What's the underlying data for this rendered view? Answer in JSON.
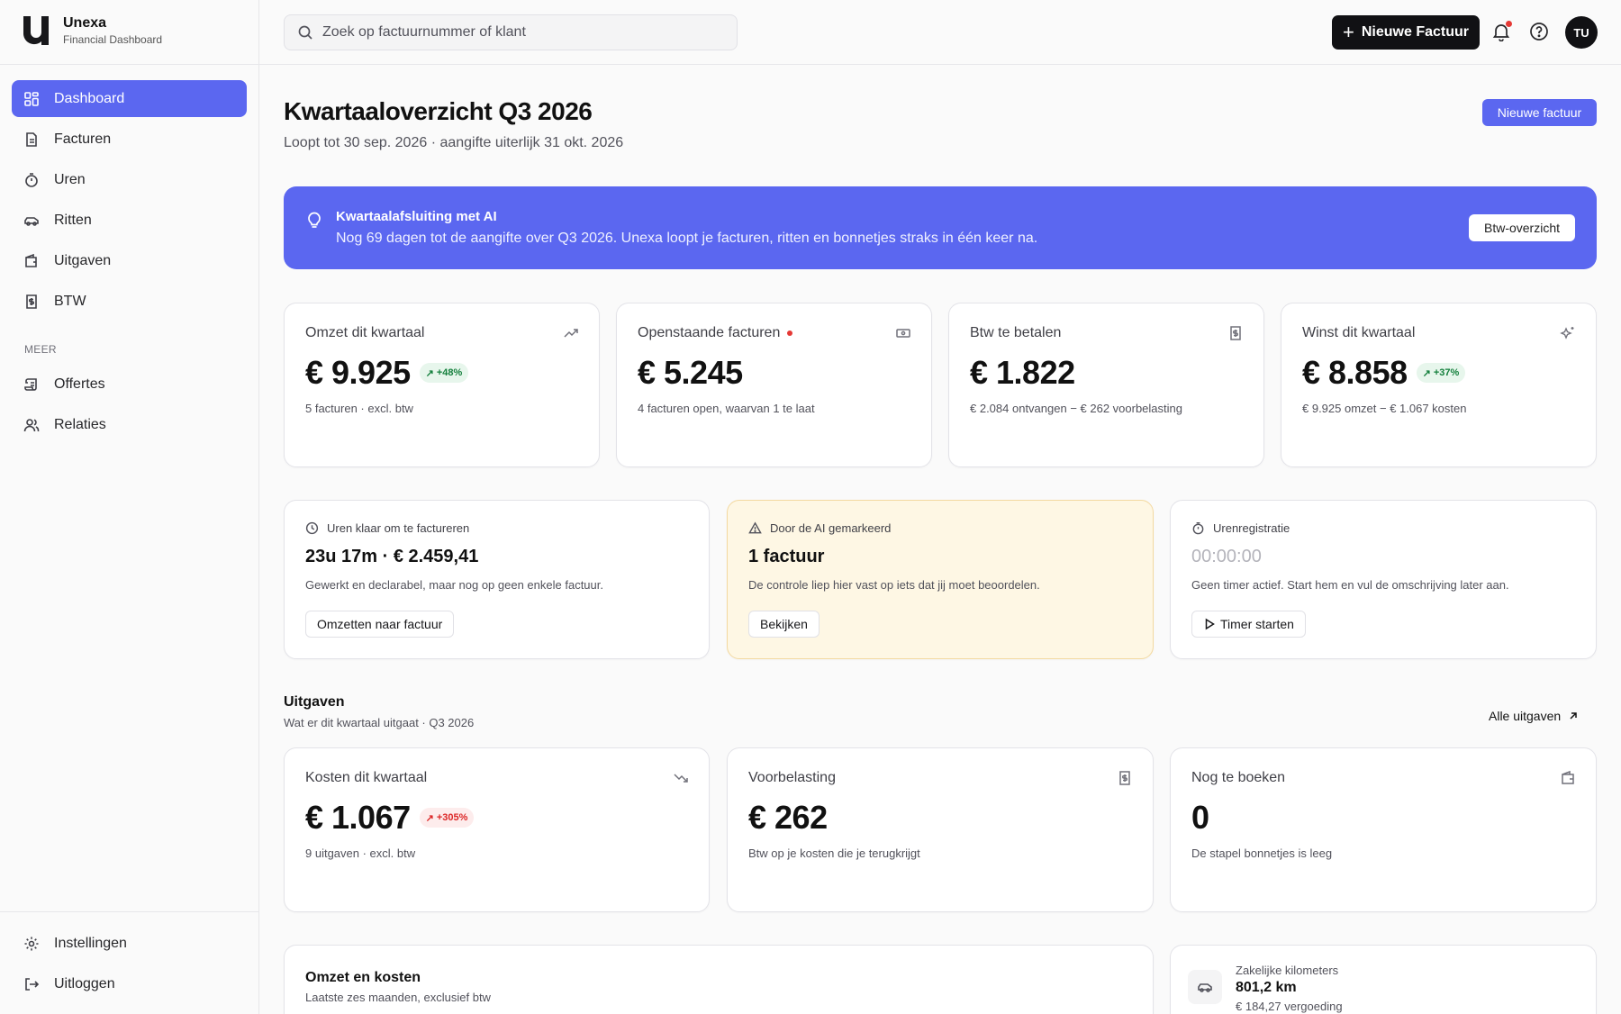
{
  "brand": {
    "name": "Unexa",
    "subtitle": "Financial Dashboard"
  },
  "sidebar": {
    "items": [
      {
        "label": "Dashboard",
        "icon": "dashboard-icon",
        "active": true
      },
      {
        "label": "Facturen",
        "icon": "file-icon"
      },
      {
        "label": "Uren",
        "icon": "stopwatch-icon"
      },
      {
        "label": "Ritten",
        "icon": "car-icon"
      },
      {
        "label": "Uitgaven",
        "icon": "wallet-icon"
      },
      {
        "label": "BTW",
        "icon": "receipt-icon"
      }
    ],
    "section_label": "MEER",
    "more_items": [
      {
        "label": "Offertes",
        "icon": "scroll-icon"
      },
      {
        "label": "Relaties",
        "icon": "users-icon"
      }
    ],
    "bottom_items": [
      {
        "label": "Instellingen",
        "icon": "gear-icon"
      },
      {
        "label": "Uitloggen",
        "icon": "logout-icon"
      }
    ]
  },
  "topbar": {
    "search_placeholder": "Zoek op factuurnummer of klant",
    "new_invoice_label": "Nieuwe Factuur",
    "avatar_initials": "TU",
    "notification_dot": true
  },
  "header": {
    "title": "Kwartaaloverzicht Q3 2026",
    "subtitle": "Loopt tot 30 sep. 2026 · aangifte uiterlijk 31 okt. 2026",
    "action_label": "Nieuwe factuur"
  },
  "banner": {
    "title": "Kwartaalafsluiting met AI",
    "text": "Nog 69 dagen tot de aangifte over Q3 2026. Unexa loopt je facturen, ritten en bonnetjes straks in één keer na.",
    "button_label": "Btw-overzicht"
  },
  "kpis": [
    {
      "label": "Omzet dit kwartaal",
      "value": "€ 9.925",
      "badge": "+48%",
      "badge_tone": "green",
      "note": "5 facturen · excl. btw",
      "icon": "trend-up-icon"
    },
    {
      "label": "Openstaande facturen",
      "value": "€ 5.245",
      "note": "4 facturen open, waarvan 1 te laat",
      "icon": "banknote-icon",
      "alert_dot": true
    },
    {
      "label": "Btw te betalen",
      "value": "€ 1.822",
      "note": "€ 2.084 ontvangen − € 262 voorbelasting",
      "icon": "receipt-icon"
    },
    {
      "label": "Winst dit kwartaal",
      "value": "€ 8.858",
      "badge": "+37%",
      "badge_tone": "green",
      "note": "€ 9.925 omzet − € 1.067 kosten",
      "icon": "sparkles-icon"
    }
  ],
  "actions": [
    {
      "head": "Uren klaar om te factureren",
      "value": "23u 17m · € 2.459,41",
      "note": "Gewerkt en declarabel, maar nog op geen enkele factuur.",
      "button": "Omzetten naar factuur",
      "icon": "clock-icon"
    },
    {
      "head": "Door de AI gemarkeerd",
      "value": "1 factuur",
      "note": "De controle liep hier vast op iets dat jij moet beoordelen.",
      "button": "Bekijken",
      "icon": "warning-icon"
    },
    {
      "head": "Urenregistratie",
      "value": "00:00:00",
      "note": "Geen timer actief. Start hem en vul de omschrijving later aan.",
      "button": "Timer starten",
      "icon": "timer-icon"
    }
  ],
  "expenses": {
    "title": "Uitgaven",
    "subtitle": "Wat er dit kwartaal uitgaat · Q3 2026",
    "link_label": "Alle uitgaven",
    "cards": [
      {
        "label": "Kosten dit kwartaal",
        "value": "€ 1.067",
        "badge": "+305%",
        "badge_tone": "red",
        "note": "9 uitgaven · excl. btw",
        "icon": "trend-down-icon"
      },
      {
        "label": "Voorbelasting",
        "value": "€ 262",
        "note": "Btw op je kosten die je terugkrijgt",
        "icon": "receipt-icon"
      },
      {
        "label": "Nog te boeken",
        "value": "0",
        "note": "De stapel bonnetjes is leeg",
        "icon": "wallet-icon"
      }
    ]
  },
  "revenue_chart": {
    "title": "Omzet en kosten",
    "subtitle": "Laatste zes maanden, exclusief btw"
  },
  "mileage": {
    "label": "Zakelijke kilometers",
    "value": "801,2 km",
    "note": "€ 184,27 vergoeding"
  },
  "colors": {
    "accent": "#5b67f0",
    "dark": "#111114",
    "positive": "#15803d",
    "negative": "#dc2626",
    "warning_bg": "#fef7e4"
  }
}
